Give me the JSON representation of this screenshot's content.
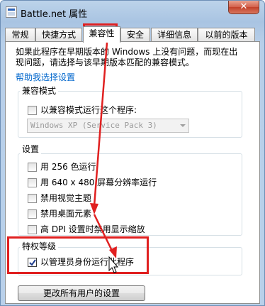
{
  "window": {
    "title": "Battle.net 属性",
    "close_glyph": "✕"
  },
  "tabs": [
    {
      "label": "常规"
    },
    {
      "label": "快捷方式"
    },
    {
      "label": "兼容性",
      "active": true
    },
    {
      "label": "安全"
    },
    {
      "label": "详细信息"
    },
    {
      "label": "以前的版本"
    }
  ],
  "compat": {
    "intro_line1": "如果此程序在早期版本的 Windows 上没有问题，而现在出",
    "intro_line2": "现问题，请选择与该早期版本匹配的兼容模式。",
    "help_link": "帮助我选择设置"
  },
  "compat_mode": {
    "title": "兼容模式",
    "checkbox_label": "以兼容模式运行这个程序:",
    "checked": false,
    "select_value": "Windows XP (Service Pack 3)"
  },
  "settings": {
    "title": "设置",
    "items": [
      {
        "label": "用 256 色运行",
        "checked": false
      },
      {
        "label": "用 640 x 480 屏幕分辨率运行",
        "checked": false
      },
      {
        "label": "禁用视觉主题",
        "checked": false
      },
      {
        "label": "禁用桌面元素",
        "checked": false
      },
      {
        "label": "高 DPI 设置时禁用显示缩放",
        "checked": false
      }
    ]
  },
  "privilege": {
    "title": "特权等级",
    "checkbox_label": "以管理员身份运行此程序",
    "checked": true
  },
  "all_users_button": "更改所有用户的设置",
  "annotation_color": "#e02020",
  "icons": [
    "app-icon",
    "close-icon",
    "checkmark-icon",
    "dropdown-arrow-icon",
    "mouse-cursor-icon"
  ]
}
